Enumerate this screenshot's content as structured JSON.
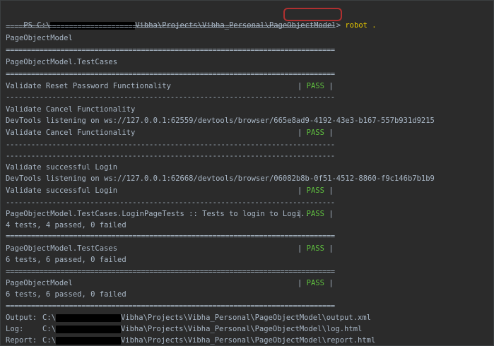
{
  "prompt": {
    "prefix": "PS C:\\",
    "path_rest": "Vibha\\Projects\\Vibha_Personal\\PageObjectModel>",
    "command": "robot ."
  },
  "separators": {
    "double": "==============================================================================",
    "single": "------------------------------------------------------------------------------"
  },
  "lines": {
    "suite_root": "PageObjectModel",
    "suite_testcases": "PageObjectModel.TestCases",
    "test1": "Validate Reset Password Functionality",
    "test2_start": "Validate Cancel Functionality",
    "devtools1": "DevTools listening on ws://127.0.0.1:62559/devtools/browser/665e8ad9-4192-43e3-b167-557b931d9215",
    "test2": "Validate Cancel Functionality",
    "test3_start": "Validate successful Login",
    "devtools2": "DevTools listening on ws://127.0.0.1:62668/devtools/browser/06082b8b-0f51-4512-8860-f9c146b7b1b9",
    "test3": "Validate successful Login",
    "login_suite": "PageObjectModel.TestCases.LoginPageTests :: Tests to login to Logi...",
    "login_summary": "4 tests, 4 passed, 0 failed",
    "testcases_suite": "PageObjectModel.TestCases",
    "testcases_summary": "6 tests, 6 passed, 0 failed",
    "root_suite": "PageObjectModel",
    "root_summary": "6 tests, 6 passed, 0 failed"
  },
  "status": {
    "pipe_left": "| ",
    "pass": "PASS",
    "pipe_right": " |"
  },
  "outputs": [
    {
      "label": "Output:",
      "drive": "C:\\",
      "path": "Vibha\\Projects\\Vibha_Personal\\PageObjectModel\\output.xml"
    },
    {
      "label": "Log:",
      "drive": "C:\\",
      "path": "Vibha\\Projects\\Vibha_Personal\\PageObjectModel\\log.html"
    },
    {
      "label": "Report:",
      "drive": "C:\\",
      "path": "Vibha\\Projects\\Vibha_Personal\\PageObjectModel\\report.html"
    }
  ],
  "colors": {
    "background": "#2b2b2b",
    "text": "#a9b7c6",
    "pass": "#5fbf3f",
    "command": "#e6c700",
    "highlight_box": "#b03030"
  }
}
